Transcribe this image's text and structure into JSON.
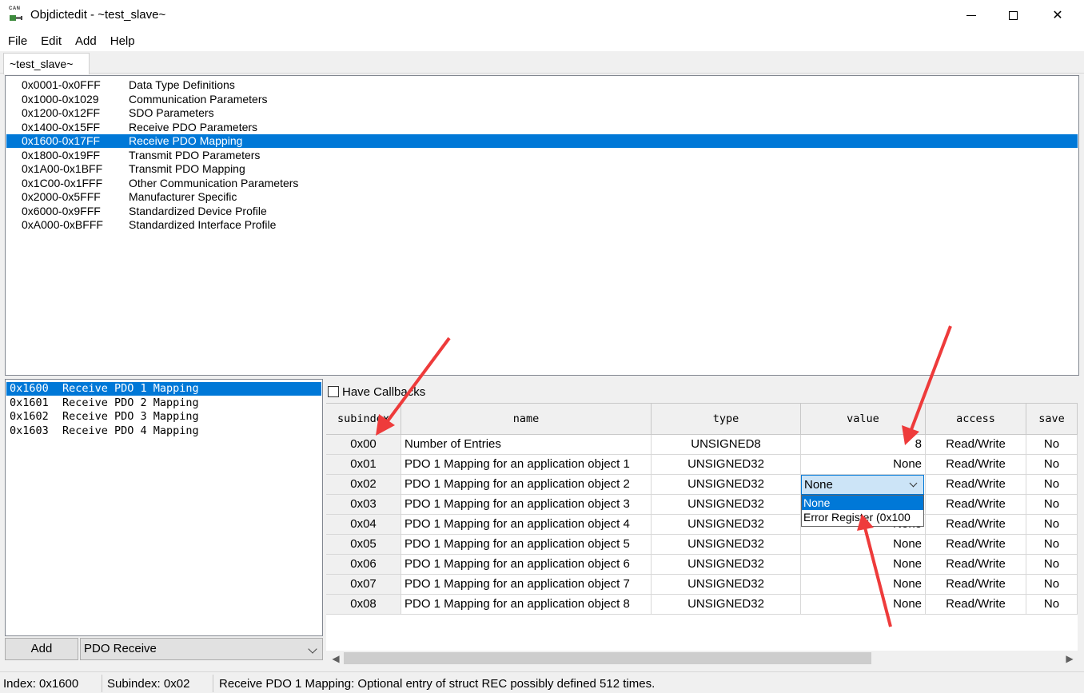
{
  "window": {
    "title": "Objdictedit - ~test_slave~",
    "icon_text": "CAN",
    "close_glyph": "✕"
  },
  "menu": [
    "File",
    "Edit",
    "Add",
    "Help"
  ],
  "tab": {
    "label": "~test_slave~"
  },
  "index_ranges": [
    {
      "range": "0x0001-0x0FFF",
      "label": "Data Type Definitions"
    },
    {
      "range": "0x1000-0x1029",
      "label": "Communication Parameters"
    },
    {
      "range": "0x1200-0x12FF",
      "label": "SDO Parameters"
    },
    {
      "range": "0x1400-0x15FF",
      "label": "Receive PDO Parameters"
    },
    {
      "range": "0x1600-0x17FF",
      "label": "Receive PDO Mapping"
    },
    {
      "range": "0x1800-0x19FF",
      "label": "Transmit PDO Parameters"
    },
    {
      "range": "0x1A00-0x1BFF",
      "label": "Transmit PDO Mapping"
    },
    {
      "range": "0x1C00-0x1FFF",
      "label": "Other Communication Parameters"
    },
    {
      "range": "0x2000-0x5FFF",
      "label": "Manufacturer Specific"
    },
    {
      "range": "0x6000-0x9FFF",
      "label": "Standardized Device Profile"
    },
    {
      "range": "0xA000-0xBFFF",
      "label": "Standardized Interface Profile"
    }
  ],
  "selected_range_index": 4,
  "index_entries": [
    {
      "index": "0x1600",
      "name": "Receive PDO 1 Mapping"
    },
    {
      "index": "0x1601",
      "name": "Receive PDO 2 Mapping"
    },
    {
      "index": "0x1602",
      "name": "Receive PDO 3 Mapping"
    },
    {
      "index": "0x1603",
      "name": "Receive PDO 4 Mapping"
    }
  ],
  "selected_entry_index": 0,
  "add_button": "Add",
  "entry_type_select": "PDO Receive",
  "have_callbacks": {
    "label": "Have Callbacks",
    "checked": false
  },
  "grid": {
    "columns": [
      "subindex",
      "name",
      "type",
      "value",
      "access",
      "save"
    ],
    "rows": [
      {
        "subindex": "0x00",
        "name": "Number of Entries",
        "type": "UNSIGNED8",
        "value": "8",
        "access": "Read/Write",
        "save": "No"
      },
      {
        "subindex": "0x01",
        "name": "PDO 1 Mapping for an application object 1",
        "type": "UNSIGNED32",
        "value": "None",
        "access": "Read/Write",
        "save": "No"
      },
      {
        "subindex": "0x02",
        "name": "PDO 1 Mapping for an application object 2",
        "type": "UNSIGNED32",
        "value": "",
        "access": "Read/Write",
        "save": "No"
      },
      {
        "subindex": "0x03",
        "name": "PDO 1 Mapping for an application object 3",
        "type": "UNSIGNED32",
        "value": "",
        "access": "Read/Write",
        "save": "No"
      },
      {
        "subindex": "0x04",
        "name": "PDO 1 Mapping for an application object 4",
        "type": "UNSIGNED32",
        "value": "None",
        "access": "Read/Write",
        "save": "No"
      },
      {
        "subindex": "0x05",
        "name": "PDO 1 Mapping for an application object 5",
        "type": "UNSIGNED32",
        "value": "None",
        "access": "Read/Write",
        "save": "No"
      },
      {
        "subindex": "0x06",
        "name": "PDO 1 Mapping for an application object 6",
        "type": "UNSIGNED32",
        "value": "None",
        "access": "Read/Write",
        "save": "No"
      },
      {
        "subindex": "0x07",
        "name": "PDO 1 Mapping for an application object 7",
        "type": "UNSIGNED32",
        "value": "None",
        "access": "Read/Write",
        "save": "No"
      },
      {
        "subindex": "0x08",
        "name": "PDO 1 Mapping for an application object 8",
        "type": "UNSIGNED32",
        "value": "None",
        "access": "Read/Write",
        "save": "No"
      }
    ],
    "editor": {
      "current": "None",
      "options": [
        "None",
        "Error Register (0x100"
      ]
    }
  },
  "status": {
    "index": "Index: 0x1600",
    "subindex": "Subindex: 0x02",
    "message": "Receive PDO 1 Mapping: Optional entry of struct REC possibly defined 512 times."
  },
  "colors": {
    "selection": "#0078d7",
    "annotation_arrow": "#ee3b3b"
  }
}
